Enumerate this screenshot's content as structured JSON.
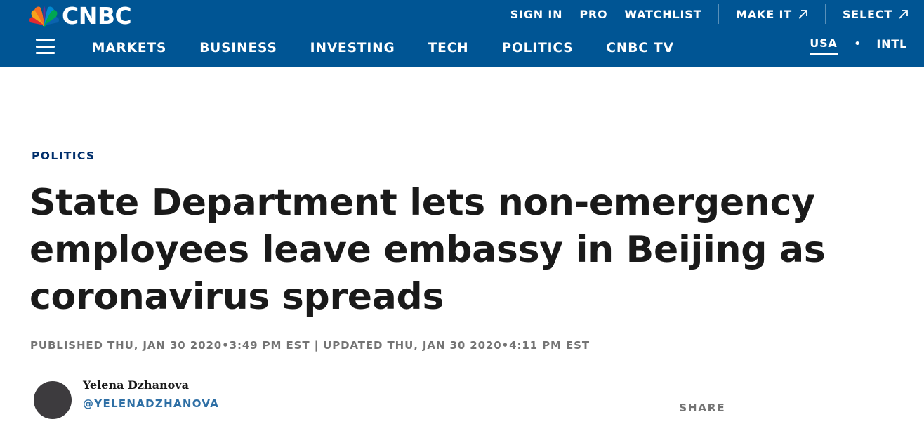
{
  "header": {
    "logo_text": "CNBC",
    "brand_color": "#005594",
    "top_links": [
      {
        "label": "SIGN IN"
      },
      {
        "label": "PRO"
      },
      {
        "label": "WATCHLIST"
      },
      {
        "label": "MAKE IT",
        "icon": "external-arrow-icon"
      },
      {
        "label": "SELECT",
        "icon": "external-arrow-icon"
      }
    ],
    "main_nav": [
      "MARKETS",
      "BUSINESS",
      "INVESTING",
      "TECH",
      "POLITICS",
      "CNBC TV"
    ],
    "region": {
      "selected": "USA",
      "separator": "•",
      "other": "INTL"
    }
  },
  "article": {
    "section": "POLITICS",
    "section_color": "#002f6c",
    "headline_lines": [
      "State Department lets non-emergency",
      "employees leave embassy in Beijing as",
      "coronavirus spreads"
    ],
    "published": "PUBLISHED THU, JAN 30 2020•3:49 PM EST",
    "divider": "|",
    "updated": "UPDATED THU, JAN 30 2020•4:11 PM EST",
    "author": {
      "name": "Yelena Dzhanova",
      "handle": "@YELENADZHANOVA"
    },
    "share_label": "SHARE"
  }
}
